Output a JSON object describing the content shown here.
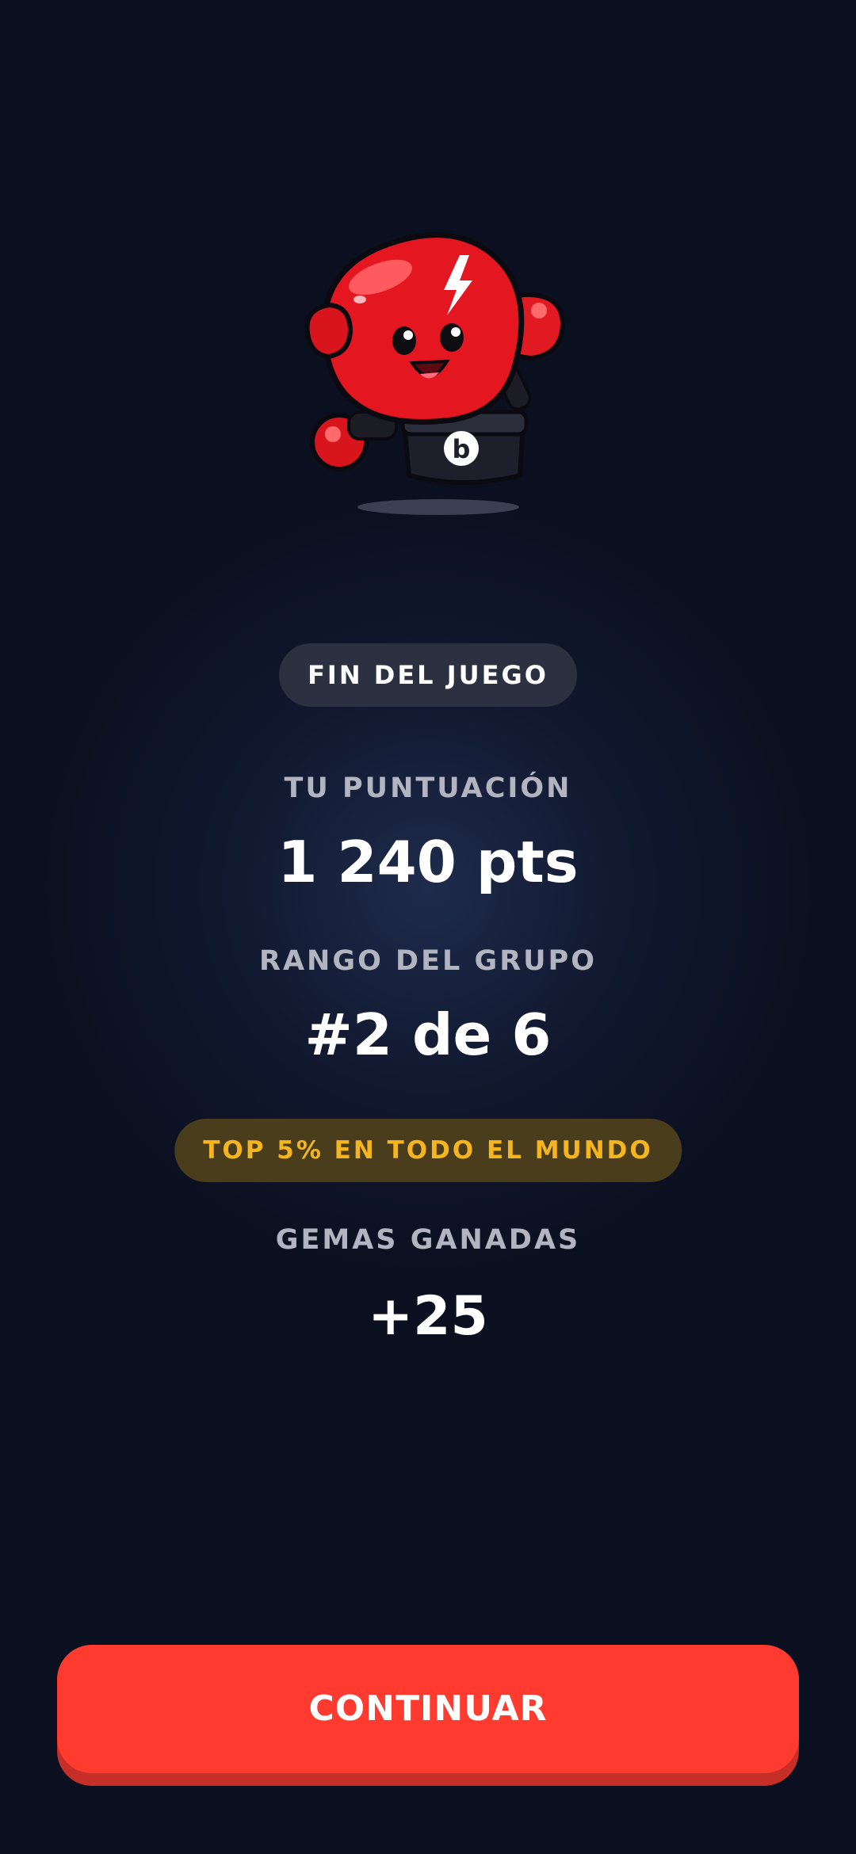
{
  "mascot": {
    "icon": "boxing-glove-mascot-icon",
    "letter": "b"
  },
  "status": {
    "game_over": "FIN DEL JUEGO"
  },
  "score": {
    "label": "TU PUNTUACIÓN",
    "value": "1 240 pts"
  },
  "rank": {
    "label": "RANGO DEL GRUPO",
    "value": "#2 de 6"
  },
  "world": {
    "badge": "TOP 5% EN TODO EL MUNDO"
  },
  "gems": {
    "label": "GEMAS GANADAS",
    "value": "+25"
  },
  "actions": {
    "continue_label": "CONTINUAR"
  },
  "colors": {
    "background": "#0b1020",
    "accent": "#ff3b30",
    "gold": "#f5b51f"
  }
}
